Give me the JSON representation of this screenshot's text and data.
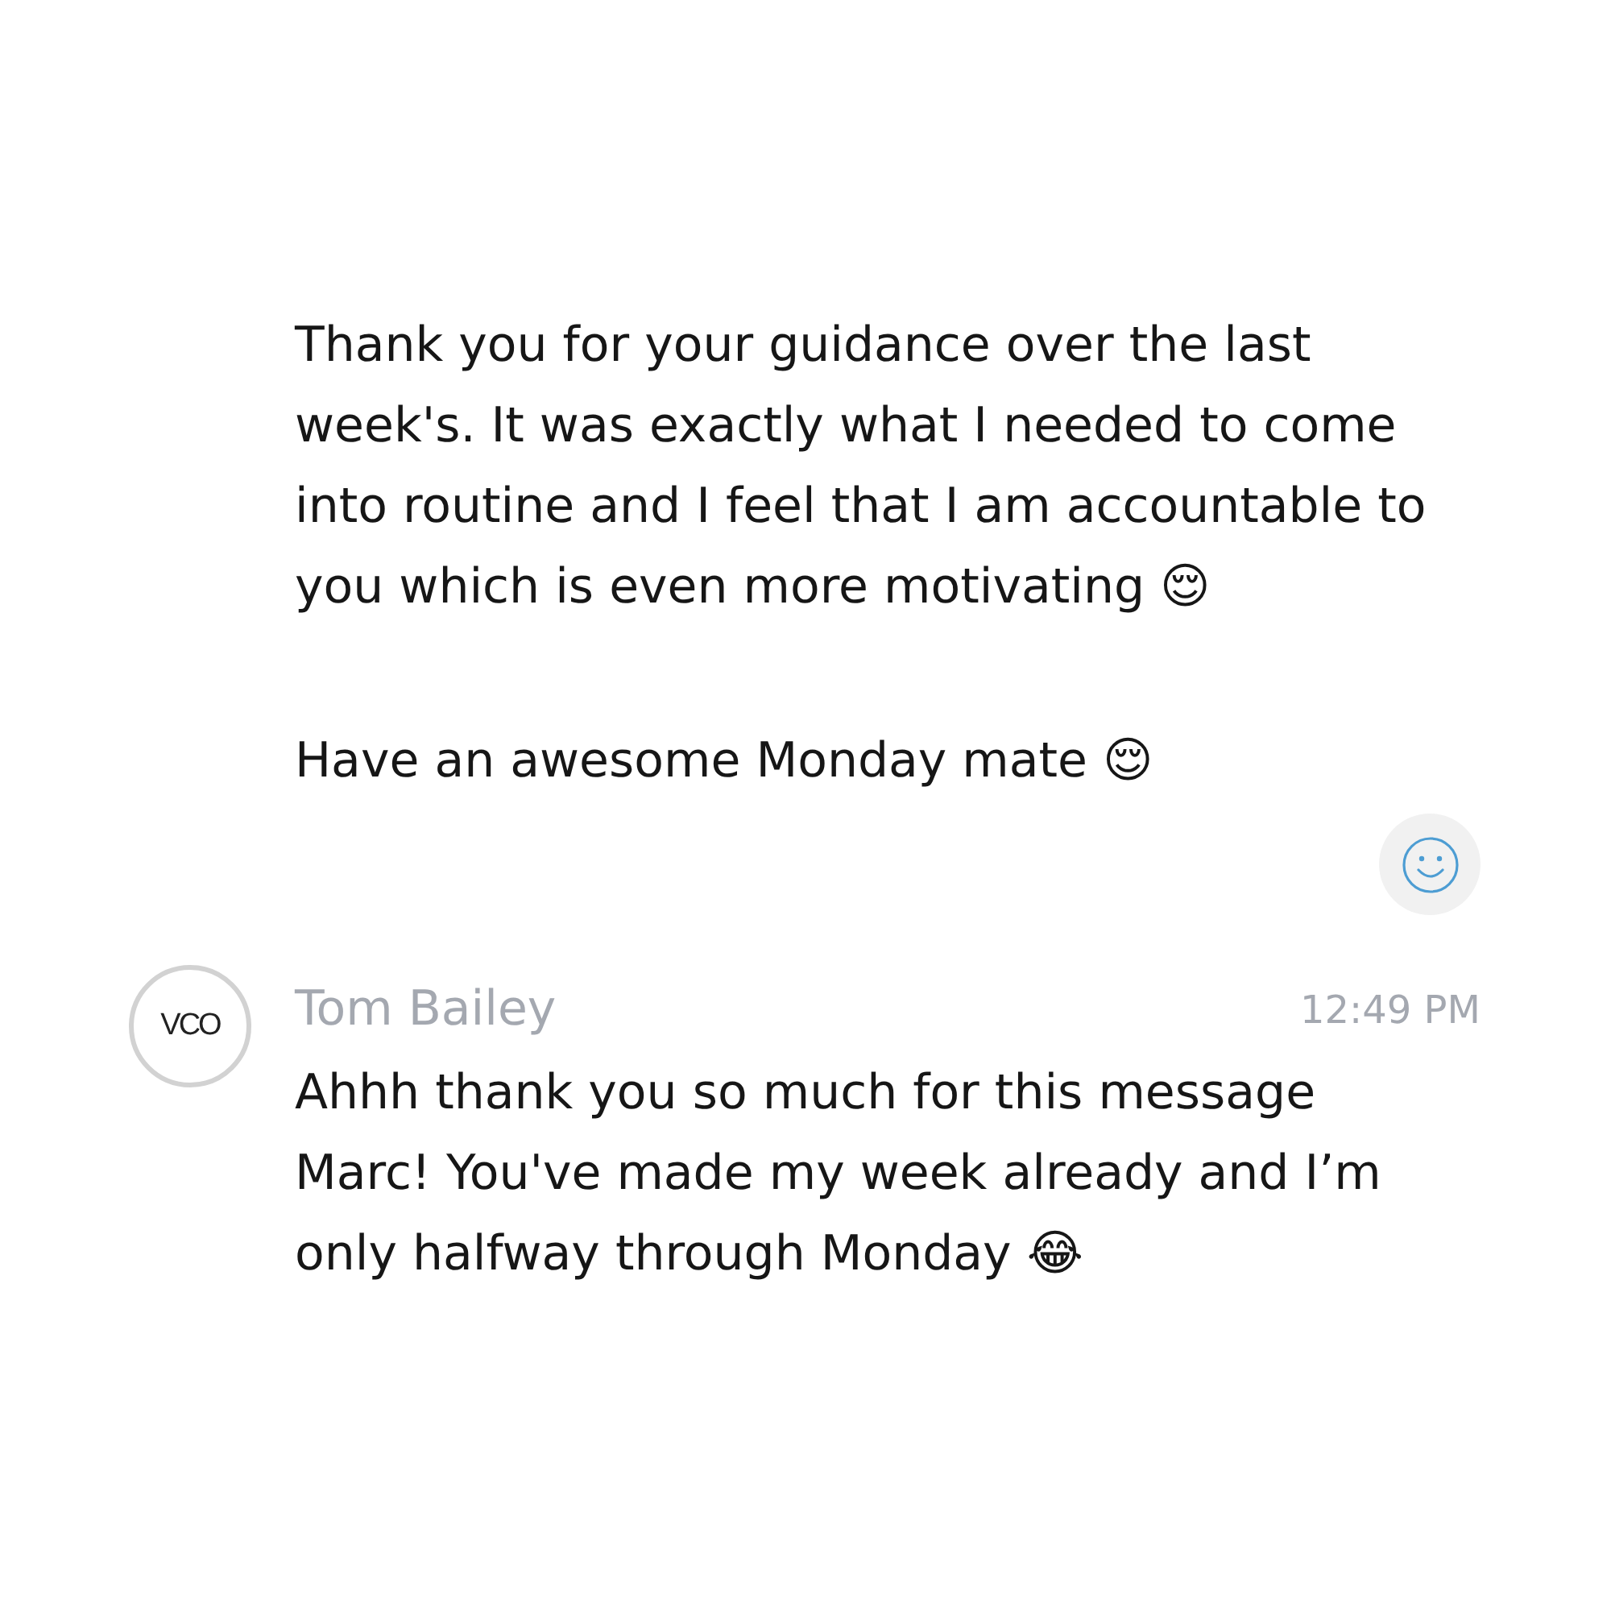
{
  "messages": [
    {
      "kind": "continuation",
      "paragraphs": [
        {
          "text": "Thank you for your guidance over the last week's. It was exactly what I needed to come into routine and I feel that I am accountable to you which is even more motivating 😌"
        },
        {
          "text": "Have an awesome Monday mate 😌"
        }
      ],
      "add_reaction_button": true
    },
    {
      "kind": "full",
      "avatar": {
        "text": "VCO"
      },
      "author": "Tom Bailey",
      "time": "12:49 PM",
      "paragraphs": [
        {
          "text": "Ahhh thank you so much for this message Marc! You've made my week already and I’m only halfway through Monday 😂"
        }
      ]
    }
  ]
}
